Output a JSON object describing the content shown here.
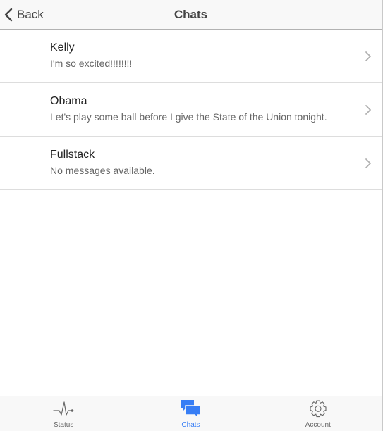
{
  "header": {
    "back_label": "Back",
    "title": "Chats"
  },
  "chats": [
    {
      "name": "Kelly",
      "last_message": "I'm so excited!!!!!!!!"
    },
    {
      "name": "Obama",
      "last_message": "Let's play some ball before I give the State of the Union tonight."
    },
    {
      "name": "Fullstack",
      "last_message": "No messages available."
    }
  ],
  "tabs": [
    {
      "label": "Status",
      "icon": "pulse-icon",
      "active": false
    },
    {
      "label": "Chats",
      "icon": "chat-bubbles-icon",
      "active": true
    },
    {
      "label": "Account",
      "icon": "gear-icon",
      "active": false
    }
  ],
  "colors": {
    "accent": "#387ef5",
    "bar_background": "#f8f8f8",
    "text": "#444444"
  }
}
